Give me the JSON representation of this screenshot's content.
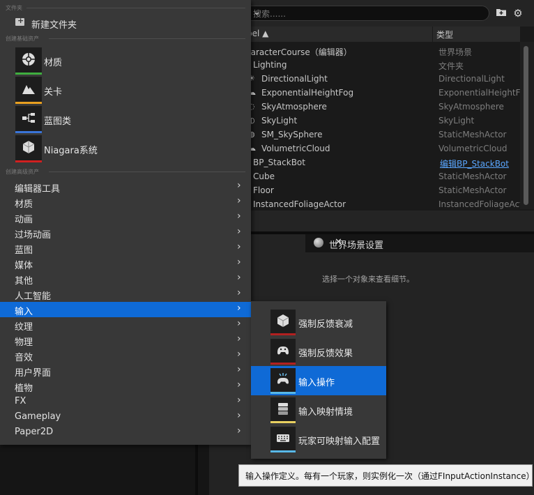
{
  "outliner": {
    "search_placeholder": "搜索......",
    "columns": {
      "label": "bel ▲",
      "type": "类型"
    },
    "rows": [
      {
        "icon": "",
        "name": "haracterCourse（编辑器）",
        "type": "世界场景",
        "link": false
      },
      {
        "icon": "",
        "name": "Lighting",
        "type": "文件夹",
        "link": false
      },
      {
        "icon": "☀",
        "name": "DirectionalLight",
        "type": "DirectionalLight",
        "link": false
      },
      {
        "icon": "☁",
        "name": "ExponentialHeightFog",
        "type": "ExponentialHeightFo",
        "link": false
      },
      {
        "icon": "◌",
        "name": "SkyAtmosphere",
        "type": "SkyAtmosphere",
        "link": false
      },
      {
        "icon": "◐",
        "name": "SkyLight",
        "type": "SkyLight",
        "link": false
      },
      {
        "icon": "◍",
        "name": "SM_SkySphere",
        "type": "StaticMeshActor",
        "link": false
      },
      {
        "icon": "☁",
        "name": "VolumetricCloud",
        "type": "VolumetricCloud",
        "link": false
      },
      {
        "icon": "",
        "name": "BP_StackBot",
        "type": "编辑BP_StackBot",
        "link": true
      },
      {
        "icon": "",
        "name": "Cube",
        "type": "StaticMeshActor",
        "link": false
      },
      {
        "icon": "",
        "name": "Floor",
        "type": "StaticMeshActor",
        "link": false
      },
      {
        "icon": "",
        "name": "InstancedFoliageActor",
        "type": "InstancedFoliageAct",
        "link": false
      }
    ]
  },
  "details": {
    "tab_close": "✕",
    "world_settings_tab": "世界场景设置",
    "hint": "选择一个对象来查看细节。"
  },
  "menu": {
    "section_folder": "文件夹",
    "new_folder": "新建文件夹",
    "section_basic": "创建基础资产",
    "basic_assets": [
      {
        "label": "材质",
        "color": "#3fae3f",
        "icon": "material-icon"
      },
      {
        "label": "关卡",
        "color": "#e8a020",
        "icon": "level-icon"
      },
      {
        "label": "蓝图类",
        "color": "#3a74d8",
        "icon": "blueprint-class-icon"
      },
      {
        "label": "Niagara系统",
        "color": "#d02020",
        "icon": "niagara-system-icon"
      }
    ],
    "section_advanced": "创建高级资产",
    "advanced": [
      "编辑器工具",
      "材质",
      "动画",
      "过场动画",
      "蓝图",
      "媒体",
      "其他",
      "人工智能",
      "输入",
      "纹理",
      "物理",
      "音效",
      "用户界面",
      "植物",
      "FX",
      "Gameplay",
      "Paper2D"
    ],
    "active_index": 8
  },
  "submenu": {
    "items": [
      {
        "label": "强制反馈衰减",
        "color": "#b22020",
        "icon": "force-feedback-attenuation-icon"
      },
      {
        "label": "强制反馈效果",
        "color": "#b22020",
        "icon": "force-feedback-effect-icon"
      },
      {
        "label": "输入操作",
        "color": "#58b8e8",
        "icon": "input-action-icon"
      },
      {
        "label": "输入映射情境",
        "color": "#e8d060",
        "icon": "input-mapping-context-icon"
      },
      {
        "label": "玩家可映射输入配置",
        "color": "#58b8e8",
        "icon": "player-mappable-input-config-icon"
      }
    ],
    "active_index": 2
  },
  "tooltip": "输入操作定义。每有一个玩家，则实例化一次（通过FInputActionInstance）"
}
